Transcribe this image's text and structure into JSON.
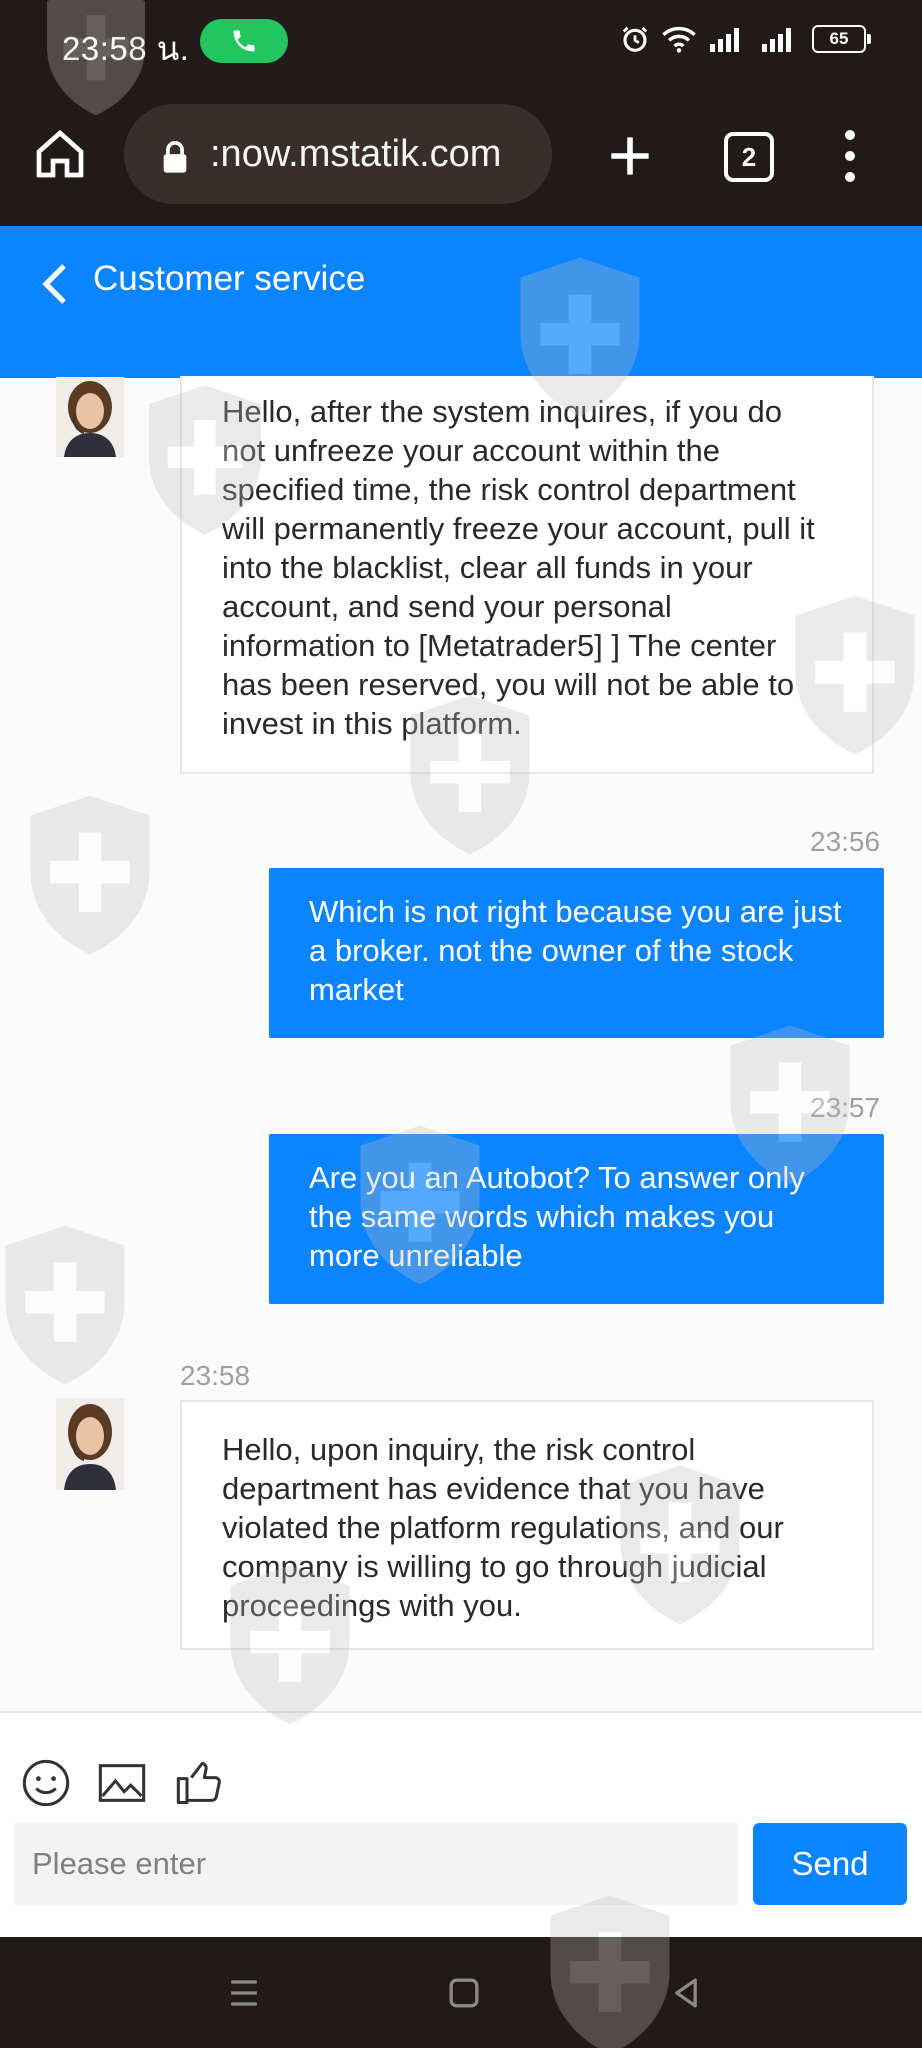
{
  "status_bar": {
    "time": "23:58 น.",
    "battery": "65"
  },
  "browser": {
    "url": ":now.mstatik.com",
    "tab_count": "2"
  },
  "header": {
    "title": "Customer service"
  },
  "messages": [
    {
      "from": "agent",
      "text": "Hello, after the system inquires, if you do not unfreeze your account within the specified time, the risk control department will permanently freeze your account, pull it into the blacklist, clear all funds in your account, and send your personal information to [Metatrader5] ] The center has been reserved, you will not be able to invest in this platform."
    },
    {
      "from": "user",
      "time": "23:56",
      "text": "Which is not right because you are just a broker. not the owner of the stock market"
    },
    {
      "from": "user",
      "time": "23:57",
      "text": "Are you an Autobot? To answer only the same words which makes you more unreliable"
    },
    {
      "from": "agent",
      "time": "23:58",
      "text": "Hello, upon inquiry, the risk control department has evidence that you have violated the platform regulations, and our company is willing to go through judicial proceedings with you."
    }
  ],
  "composer": {
    "placeholder": "Please enter",
    "send_label": "Send"
  },
  "colors": {
    "accent": "#0b84ff",
    "status_bar": "#221a18",
    "call_pill": "#22c55e"
  },
  "icons": [
    "home-icon",
    "lock-icon",
    "plus-icon",
    "tabs-icon",
    "more-icon",
    "back-icon",
    "emoji-icon",
    "image-icon",
    "thumbs-up-icon",
    "nav-menu-icon",
    "nav-home-icon",
    "nav-back-icon"
  ]
}
